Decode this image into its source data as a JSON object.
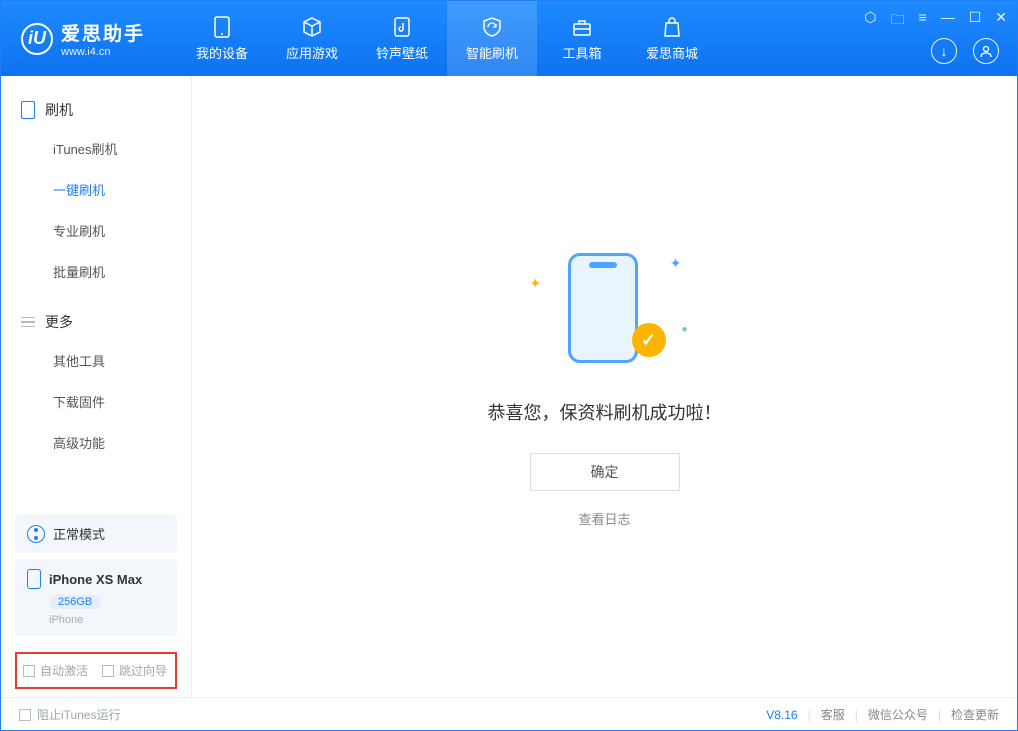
{
  "logo": {
    "title": "爱思助手",
    "subtitle": "www.i4.cn",
    "badge": "iU"
  },
  "nav": {
    "device": "我的设备",
    "apps": "应用游戏",
    "ringtone": "铃声壁纸",
    "flash": "智能刷机",
    "toolbox": "工具箱",
    "store": "爱思商城"
  },
  "sidebar": {
    "sec_flash": "刷机",
    "items_flash": {
      "itunes": "iTunes刷机",
      "oneclick": "一键刷机",
      "pro": "专业刷机",
      "batch": "批量刷机"
    },
    "sec_more": "更多",
    "items_more": {
      "other": "其他工具",
      "firmware": "下载固件",
      "advanced": "高级功能"
    }
  },
  "mode": {
    "label": "正常模式"
  },
  "device": {
    "name": "iPhone XS Max",
    "storage": "256GB",
    "type": "iPhone"
  },
  "options": {
    "auto_activate": "自动激活",
    "skip_guide": "跳过向导"
  },
  "main": {
    "success_msg": "恭喜您，保资料刷机成功啦！",
    "ok": "确定",
    "view_log": "查看日志"
  },
  "footer": {
    "block_itunes": "阻止iTunes运行",
    "version": "V8.16",
    "support": "客服",
    "wechat": "微信公众号",
    "update": "检查更新"
  }
}
